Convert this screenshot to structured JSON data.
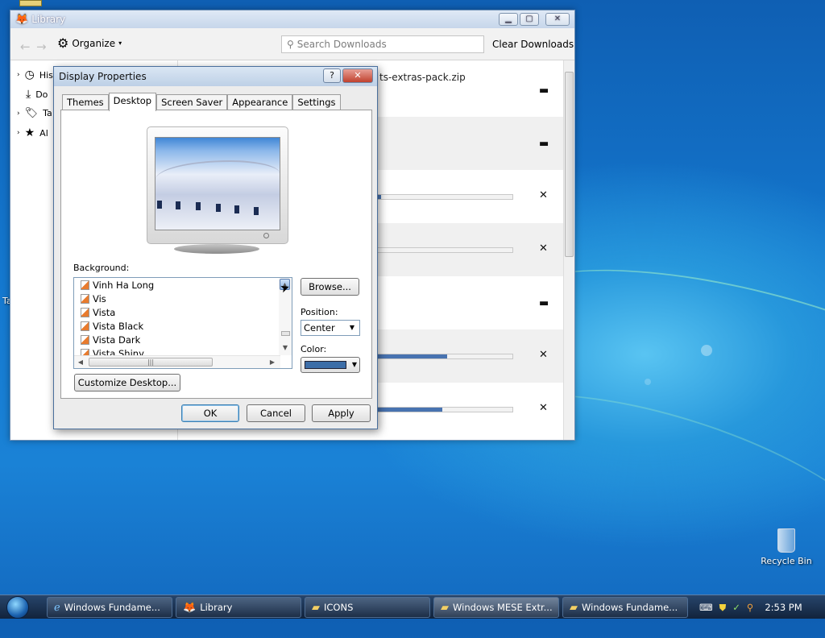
{
  "library": {
    "title": "Library",
    "toolbar": {
      "organize": "Organize",
      "search_placeholder": "Search Downloads",
      "clear_downloads": "Clear Downloads"
    },
    "sidebar": [
      {
        "label": "History",
        "icon": "clock-icon"
      },
      {
        "label": "Do",
        "icon": "download-icon"
      },
      {
        "label": "Ta",
        "icon": "tag-icon"
      },
      {
        "label": "Al",
        "icon": "star-icon"
      }
    ],
    "downloads": [
      {
        "name": "ts-extras-pack.zip",
        "action": "folder",
        "progress": null
      },
      {
        "name": "",
        "action": "folder",
        "progress": null
      },
      {
        "name": "",
        "action": "cancel",
        "progress": 0.03
      },
      {
        "name": "",
        "action": "cancel",
        "progress": 0.0
      },
      {
        "name": "",
        "action": "folder",
        "progress": null
      },
      {
        "name": "",
        "action": "cancel",
        "progress": 0.52
      },
      {
        "name": "",
        "action": "cancel",
        "progress": 0.48
      }
    ]
  },
  "dialog": {
    "title": "Display Properties",
    "help_button": "?",
    "close_button": "✕",
    "tabs": [
      "Themes",
      "Desktop",
      "Screen Saver",
      "Appearance",
      "Settings"
    ],
    "active_tab": "Desktop",
    "background_label": "Background:",
    "backgrounds": [
      "Vinh Ha Long",
      "Vis",
      "Vista",
      "Vista Black",
      "Vista Dark",
      "Vista Shiny"
    ],
    "browse_button": "Browse...",
    "position_label": "Position:",
    "position_value": "Center",
    "color_label": "Color:",
    "color_value": "#3d6ea8",
    "customize_button": "Customize Desktop...",
    "ok_button": "OK",
    "cancel_button": "Cancel",
    "apply_button": "Apply"
  },
  "desktop": {
    "left_edge_text": "Ta",
    "recycle_bin": "Recycle Bin"
  },
  "taskbar": {
    "items": [
      {
        "label": "Windows Fundame...",
        "icon": "ie-icon",
        "active": false
      },
      {
        "label": "Library",
        "icon": "firefox-icon",
        "active": false
      },
      {
        "label": "ICONS",
        "icon": "folder-icon",
        "active": false
      },
      {
        "label": "Windows MESE Extr...",
        "icon": "folder-icon",
        "active": true
      },
      {
        "label": "Windows Fundame...",
        "icon": "folder-icon",
        "active": false
      }
    ],
    "clock": "2:53 PM"
  }
}
